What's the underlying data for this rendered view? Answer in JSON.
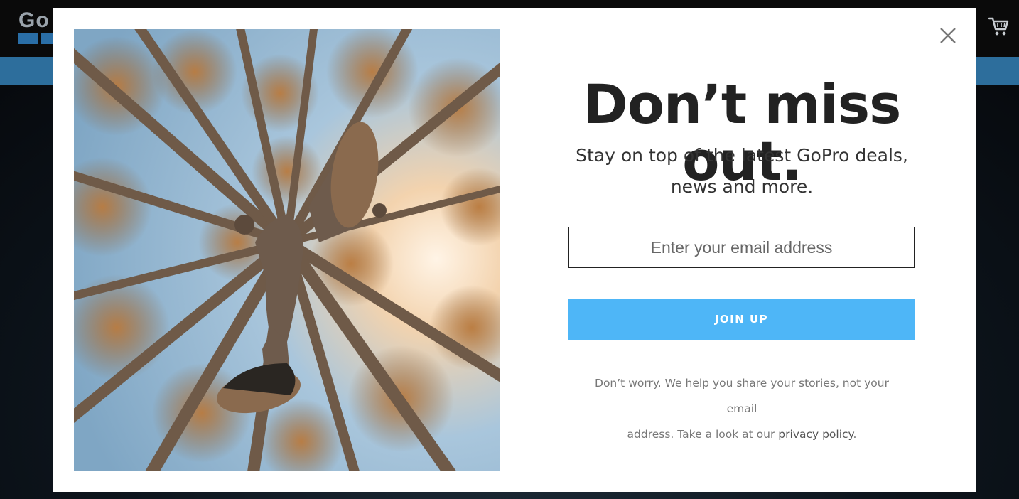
{
  "site": {
    "logo_text": "Go",
    "promo_text": ""
  },
  "modal": {
    "headline": "Don’t miss out.",
    "subtext_line1": "Stay on top of the latest GoPro deals,",
    "subtext_line2": "news and more.",
    "email_placeholder": "Enter your email address",
    "email_value": "",
    "join_label": "JOIN UP",
    "disclaimer_line1": "Don’t worry. We help you share your stories, not your email",
    "disclaimer_prefix": "address. Take a look at our ",
    "privacy_link": "privacy policy",
    "disclaimer_suffix": ".",
    "close_icon": "close-icon",
    "image": "forest-jump-photo"
  },
  "colors": {
    "join_button": "#4eb6f7",
    "promo_bar": "#2d6e9c",
    "header_bg": "#0a0a0a"
  }
}
